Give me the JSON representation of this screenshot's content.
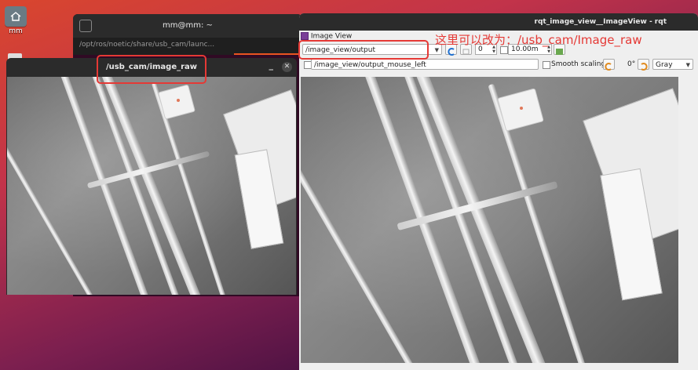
{
  "desktop": {
    "home_label": "mm"
  },
  "terminal": {
    "title": "mm@mm: ~",
    "tab_path": "/opt/ros/noetic/share/usb_cam/launc...",
    "line": ""
  },
  "image_window": {
    "title": "/usb_cam/image_raw",
    "min_glyph": "_",
    "close_glyph": "✕"
  },
  "rqt": {
    "window_title": "rqt_image_view__ImageView - rqt",
    "plugin_title": "Image View",
    "topic_selected": "/image_view/output",
    "spin_value": "0",
    "max_value": "10.00m",
    "mouse_topic": "/image_view/output_mouse_left",
    "smooth_label": "Smooth scaling",
    "rotation": "0°",
    "color_scheme": "Gray"
  },
  "annotation": {
    "text": "这里可以改为：/usb_cam/Image_raw",
    "color": "#e53935"
  }
}
